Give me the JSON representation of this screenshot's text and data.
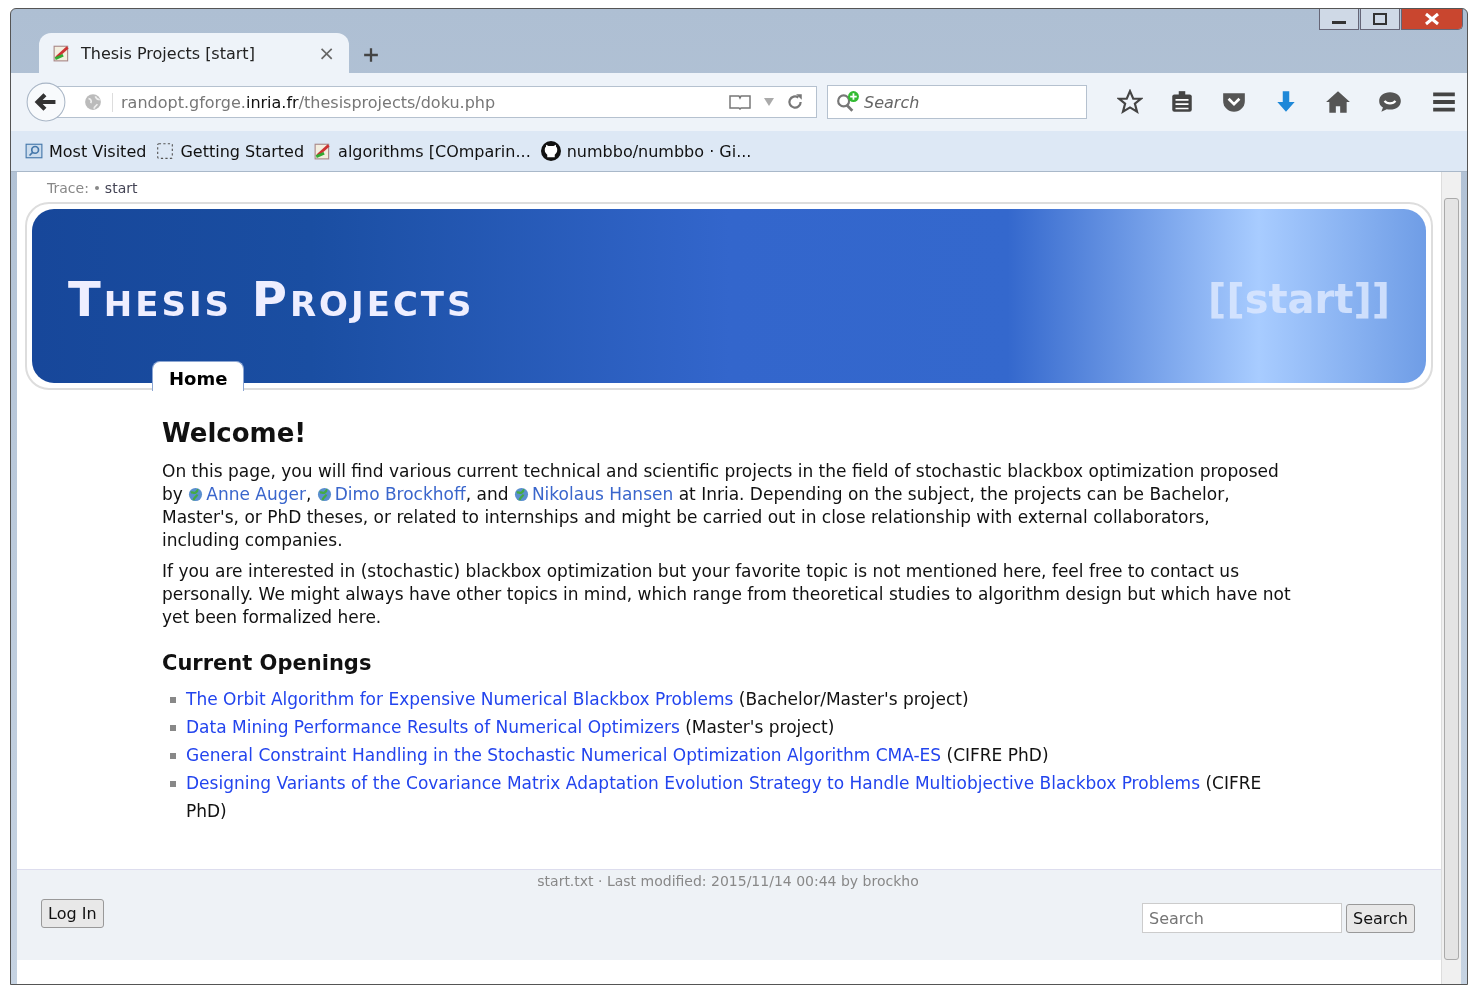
{
  "browser": {
    "tab": {
      "title": "Thesis Projects [start]",
      "close": "×",
      "selected": true
    },
    "url": {
      "host_pre": "randopt.gforge.",
      "host_main": "inria.fr",
      "path": "/thesisprojects/doku.php"
    },
    "search": {
      "placeholder": "Search"
    },
    "bookmarks": [
      {
        "label": "Most Visited",
        "kind": "folder"
      },
      {
        "label": "Getting Started",
        "kind": "blank"
      },
      {
        "label": "algorithms [COmparin...",
        "kind": "wiki"
      },
      {
        "label": "numbbo/numbbo · Gi...",
        "kind": "github"
      }
    ]
  },
  "breadcrumb": {
    "label": "Trace:",
    "items": [
      "start"
    ]
  },
  "header": {
    "title": "Thesis Projects",
    "pagename": "[[start]]",
    "tabs": [
      {
        "label": "Home",
        "selected": true
      }
    ]
  },
  "content": {
    "heading": "Welcome!",
    "intro": [
      {
        "kind": "text",
        "text": "On this page, you will find various current technical and scientific projects in the field of stochastic blackbox optimization proposed by "
      },
      {
        "kind": "link",
        "text": "Anne Auger"
      },
      {
        "kind": "text",
        "text": ", "
      },
      {
        "kind": "link",
        "text": "Dimo Brockhoff"
      },
      {
        "kind": "text",
        "text": ", and "
      },
      {
        "kind": "link",
        "text": "Nikolaus Hansen"
      },
      {
        "kind": "text",
        "text": " at Inria. Depending on the subject, the projects can be Bachelor, Master's, or PhD theses, or related to internships and might be carried out in close relationship with external collaborators, including companies."
      }
    ],
    "paragraph": "If you are interested in (stochastic) blackbox optimization but your favorite topic is not mentioned here, feel free to contact us personally. We might always have other topics in mind, which range from theoretical studies to algorithm design but which have not yet been formalized here.",
    "openings_heading": "Current Openings",
    "openings": [
      {
        "title": "The Orbit Algorithm for Expensive Numerical Blackbox Problems",
        "note": "(Bachelor/Master's project)"
      },
      {
        "title": "Data Mining Performance Results of Numerical Optimizers",
        "note": "(Master's project)"
      },
      {
        "title": "General Constraint Handling in the Stochastic Numerical Optimization Algorithm CMA-ES",
        "note": "(CIFRE PhD)"
      },
      {
        "title": "Designing Variants of the Covariance Matrix Adaptation Evolution Strategy to Handle Multiobjective Blackbox Problems",
        "note": "(CIFRE PhD)"
      }
    ]
  },
  "footer": {
    "info": "start.txt · Last modified: 2015/11/14 00:44 by brockho",
    "login": "Log In",
    "search_placeholder": "Search",
    "search_button": "Search"
  }
}
